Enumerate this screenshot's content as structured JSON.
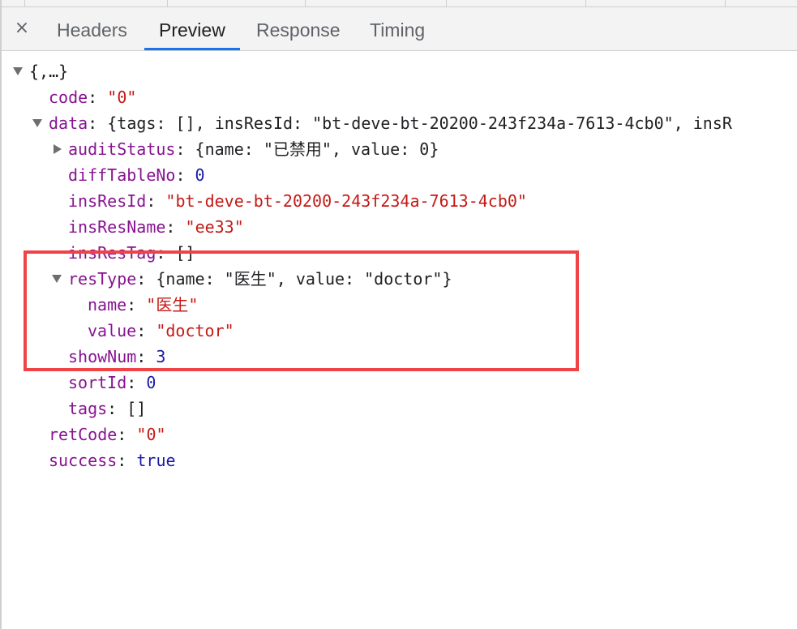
{
  "tabs": {
    "close_symbol": "×",
    "items": [
      {
        "label": "Headers",
        "active": false
      },
      {
        "label": "Preview",
        "active": true
      },
      {
        "label": "Response",
        "active": false
      },
      {
        "label": "Timing",
        "active": false
      }
    ]
  },
  "preview": {
    "root_summary": "{,…}",
    "code": {
      "key": "code",
      "value": "0"
    },
    "data": {
      "key": "data",
      "summary": "{tags: [], insResId: \"bt-deve-bt-20200-243f234a-7613-4cb0\", insR",
      "auditStatus": {
        "key": "auditStatus",
        "summary": "{name: \"已禁用\", value: 0}"
      },
      "diffTableNo": {
        "key": "diffTableNo",
        "value": "0"
      },
      "insResId": {
        "key": "insResId",
        "value": "bt-deve-bt-20200-243f234a-7613-4cb0"
      },
      "insResName": {
        "key": "insResName",
        "value": "ee33"
      },
      "insResTag": {
        "key": "insResTag",
        "value": "[]"
      },
      "resType": {
        "key": "resType",
        "summary": "{name: \"医生\", value: \"doctor\"}",
        "name": {
          "key": "name",
          "value": "医生"
        },
        "value": {
          "key": "value",
          "value": "doctor"
        }
      },
      "showNum": {
        "key": "showNum",
        "value": "3"
      },
      "sortId": {
        "key": "sortId",
        "value": "0"
      },
      "tags": {
        "key": "tags",
        "value": "[]"
      }
    },
    "retCode": {
      "key": "retCode",
      "value": "0"
    },
    "success": {
      "key": "success",
      "value": "true"
    }
  },
  "colors": {
    "highlight": "#f04346",
    "tab_underline": "#1a73e8",
    "key": "#881391",
    "string": "#c41a16",
    "number": "#1a1aa6"
  }
}
